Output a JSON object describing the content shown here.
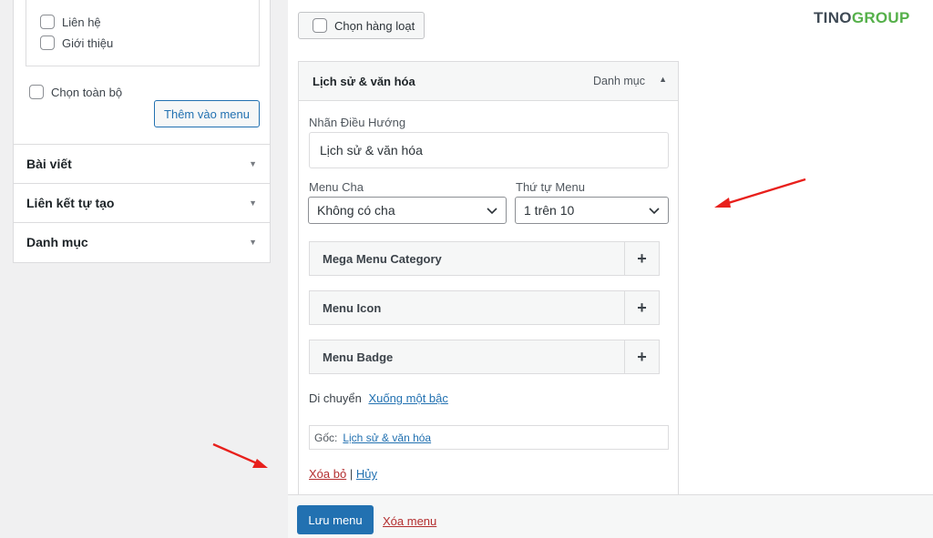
{
  "left_panel": {
    "page_items": [
      "Liên hệ",
      "Giới thiệu"
    ],
    "select_all_label": "Chọn toàn bộ",
    "add_to_menu_label": "Thêm vào menu",
    "sections": [
      "Bài viết",
      "Liên kết tự tạo",
      "Danh mục"
    ]
  },
  "toolbar": {
    "bulk_select_label": "Chọn hàng loạt"
  },
  "logo": {
    "part1": "TINO",
    "part2": "GROUP"
  },
  "menu_item": {
    "title": "Lịch sử & văn hóa",
    "type": "Danh mục",
    "nav_label_caption": "Nhãn Điều Hướng",
    "nav_label_value": "Lịch sử & văn hóa",
    "parent_caption": "Menu Cha",
    "parent_value": "Không có cha",
    "order_caption": "Thứ tự Menu",
    "order_value": "1 trên 10",
    "sub_sections": [
      "Mega Menu Category",
      "Menu Icon",
      "Menu Badge"
    ],
    "move_label": "Di chuyển",
    "move_link": "Xuống một bậc",
    "original_label": "Gốc:",
    "original_link": "Lịch sử & văn hóa",
    "remove_label": "Xóa bỏ",
    "separator": "|",
    "cancel_label": "Hủy"
  },
  "footer": {
    "save_label": "Lưu menu",
    "delete_label": "Xóa menu"
  },
  "colors": {
    "primary": "#2271b1",
    "danger": "#b32d2e",
    "arrow": "#e8201c",
    "logo_green": "#55b04a"
  }
}
